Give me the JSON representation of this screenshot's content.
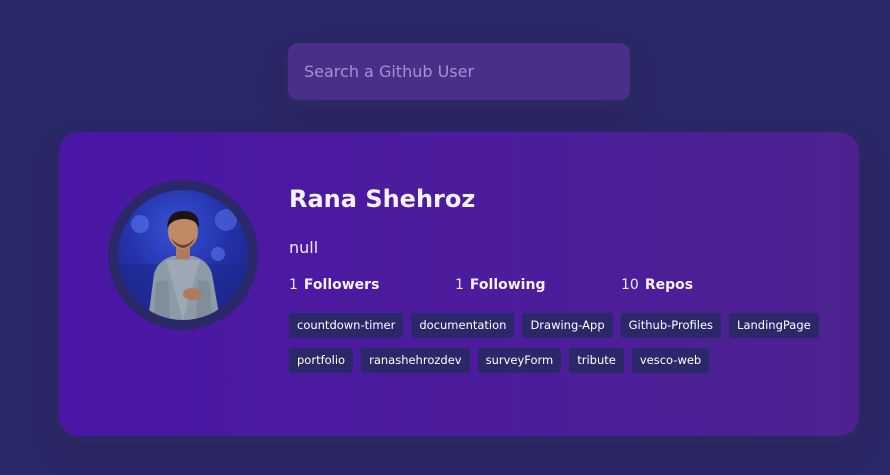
{
  "search": {
    "placeholder": "Search a Github User",
    "value": ""
  },
  "colors": {
    "background": "#2b2867",
    "card_start": "#4a17a6",
    "card_end": "#4d2290",
    "search_bg": "#4a2e8a",
    "repo_bg": "#2a2868"
  },
  "profile": {
    "avatar_icon": "user-avatar-photo",
    "name": "Rana Shehroz",
    "bio": "null",
    "stats": [
      {
        "count": "1",
        "label": "Followers"
      },
      {
        "count": "1",
        "label": "Following"
      },
      {
        "count": "10",
        "label": "Repos"
      }
    ],
    "repos": [
      "countdown-timer",
      "documentation",
      "Drawing-App",
      "Github-Profiles",
      "LandingPage",
      "portfolio",
      "ranashehrozdev",
      "surveyForm",
      "tribute",
      "vesco-web"
    ]
  }
}
